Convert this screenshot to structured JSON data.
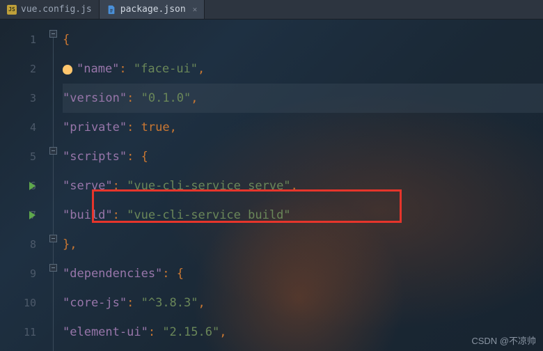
{
  "tabs": [
    {
      "label": "vue.config.js",
      "iconName": "js-file-icon"
    },
    {
      "label": "package.json",
      "iconName": "json-file-icon"
    }
  ],
  "gutter": [
    "1",
    "2",
    "3",
    "4",
    "5",
    "6",
    "7",
    "8",
    "9",
    "10",
    "11"
  ],
  "code": {
    "l1": "{",
    "l2_key": "\"name\"",
    "l2_val": "\"face-ui\"",
    "l3_key": "\"version\"",
    "l3_val": "\"0.1.0\"",
    "l4_key": "\"private\"",
    "l4_val": "true",
    "l5_key": "\"scripts\"",
    "l5_val": "{",
    "l6_key": "\"serve\"",
    "l6_val": "\"vue-cli-service serve\"",
    "l7_key": "\"build\"",
    "l7_val": "\"vue-cli-service build\"",
    "l8": "},",
    "l9_key": "\"dependencies\"",
    "l9_val": "{",
    "l10_key": "\"core-js\"",
    "l10_val": "\"^3.8.3\"",
    "l11_key": "\"element-ui\"",
    "l11_val": "\"2.15.6\""
  },
  "punct": {
    "colon": ": ",
    "comma": ","
  },
  "watermark": "CSDN @不凉帅"
}
